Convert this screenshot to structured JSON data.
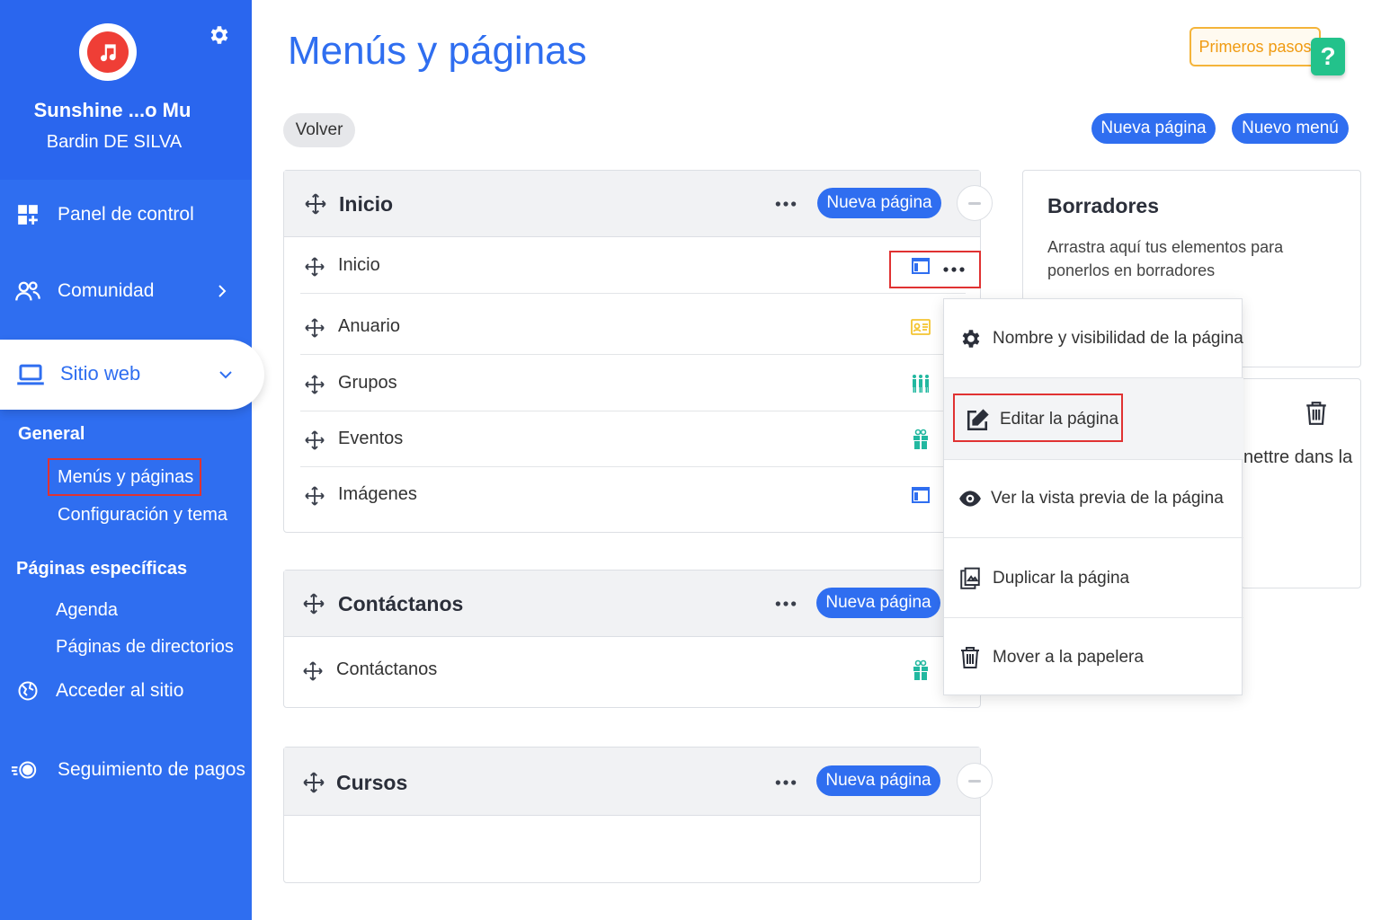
{
  "sidebar": {
    "site_title": "Sunshine ...o Mu",
    "user_name": "Bardin DE SILVA",
    "nav": {
      "dashboard": "Panel de control",
      "community": "Comunidad",
      "website": "Sitio web",
      "access_site": "Acceder al sitio",
      "payments": "Seguimiento de pagos"
    },
    "general_heading": "General",
    "general_links": [
      "Menús y páginas",
      "Configuración y tema"
    ],
    "specific_heading": "Páginas específicas",
    "specific_links": [
      "Agenda",
      "Páginas de directorios"
    ]
  },
  "header": {
    "title": "Menús y páginas",
    "getting_started": "Primeros pasos",
    "help": "?",
    "back": "Volver",
    "new_page": "Nueva página",
    "new_menu": "Nuevo menú"
  },
  "menus": [
    {
      "name": "Inicio",
      "add_label": "Nueva página",
      "pages": [
        "Inicio",
        "Anuario",
        "Grupos",
        "Eventos",
        "Imágenes"
      ]
    },
    {
      "name": "Contáctanos",
      "add_label": "Nueva página",
      "pages": [
        "Contáctanos"
      ]
    },
    {
      "name": "Cursos",
      "add_label": "Nueva página",
      "pages": []
    }
  ],
  "drafts": {
    "title": "Borradores",
    "description": "Arrastra aquí tus elementos para ponerlos en borradores"
  },
  "trash": {
    "partial_text": "nettre dans la"
  },
  "dropdown": {
    "items": [
      {
        "label": "Nombre y visibilidad de la página",
        "icon": "gear-icon"
      },
      {
        "label": "Editar la página",
        "icon": "edit-icon"
      },
      {
        "label": "Ver la vista previa de la página",
        "icon": "eye-icon"
      },
      {
        "label": "Duplicar la página",
        "icon": "duplicate-icon"
      },
      {
        "label": "Mover a la papelera",
        "icon": "trash-icon"
      }
    ]
  },
  "colors": {
    "sidebar": "#2f6ef0",
    "accent": "#2f6ef0",
    "highlight_box": "#e03232",
    "getting_started": "#f09b12",
    "help_badge": "#23c28b",
    "icon_page": "#2f6ef0",
    "icon_directory": "#f4c430",
    "icon_groups": "#22b8a0",
    "icon_events": "#22b8a0"
  }
}
